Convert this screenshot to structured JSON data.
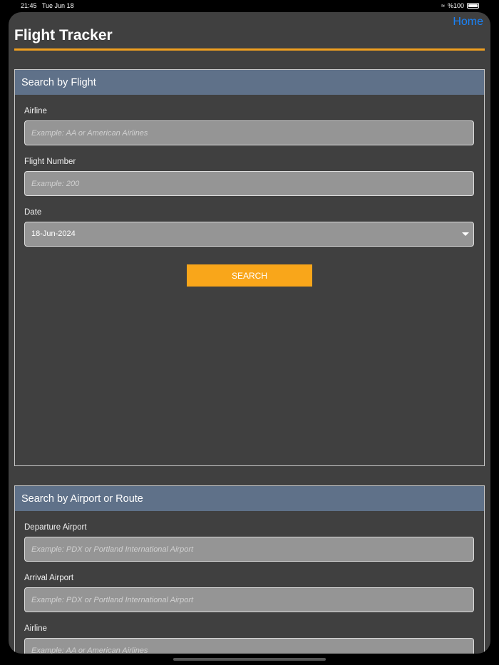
{
  "status": {
    "time": "21:45",
    "date": "Tue Jun 18",
    "battery": "%100"
  },
  "header": {
    "title": "Flight Tracker",
    "home": "Home"
  },
  "flight": {
    "title": "Search by Flight",
    "airline_label": "Airline",
    "airline_placeholder": "Example: AA or American Airlines",
    "number_label": "Flight Number",
    "number_placeholder": "Example: 200",
    "date_label": "Date",
    "date_value": "18-Jun-2024",
    "search": "SEARCH"
  },
  "route": {
    "title": "Search by Airport or Route",
    "dep_label": "Departure Airport",
    "dep_placeholder": "Example: PDX or Portland International Airport",
    "arr_label": "Arrival Airport",
    "arr_placeholder": "Example: PDX or Portland International Airport",
    "airline_label": "Airline",
    "airline_placeholder": "Example: AA or American Airlines"
  }
}
